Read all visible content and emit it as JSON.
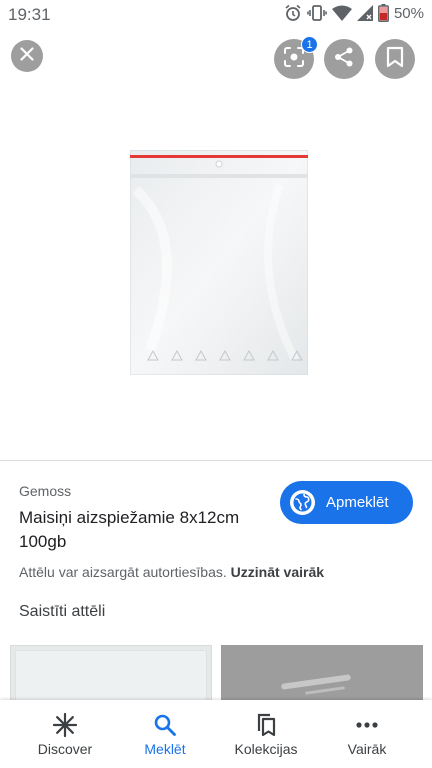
{
  "status_bar": {
    "time": "19:31",
    "battery": "50%"
  },
  "toolbar": {
    "lens_badge": "1"
  },
  "result": {
    "source": "Gemoss",
    "title": "Maisiņi aizspiežamie 8x12cm 100gb",
    "visit_label": "Apmeklēt",
    "copyright_text": "Attēlu var aizsargāt autortiesības.",
    "learn_more": "Uzzināt vairāk"
  },
  "related": {
    "heading": "Saistīti attēli"
  },
  "nav": {
    "items": [
      {
        "label": "Discover",
        "icon": "asterisk-icon"
      },
      {
        "label": "Meklēt",
        "icon": "search-icon",
        "active": true
      },
      {
        "label": "Kolekcijas",
        "icon": "collections-icon"
      },
      {
        "label": "Vairāk",
        "icon": "more-icon"
      }
    ]
  },
  "colors": {
    "accent": "#1a73e8",
    "button_gray": "#9e9e9e",
    "bag_seal": "#e53935"
  }
}
